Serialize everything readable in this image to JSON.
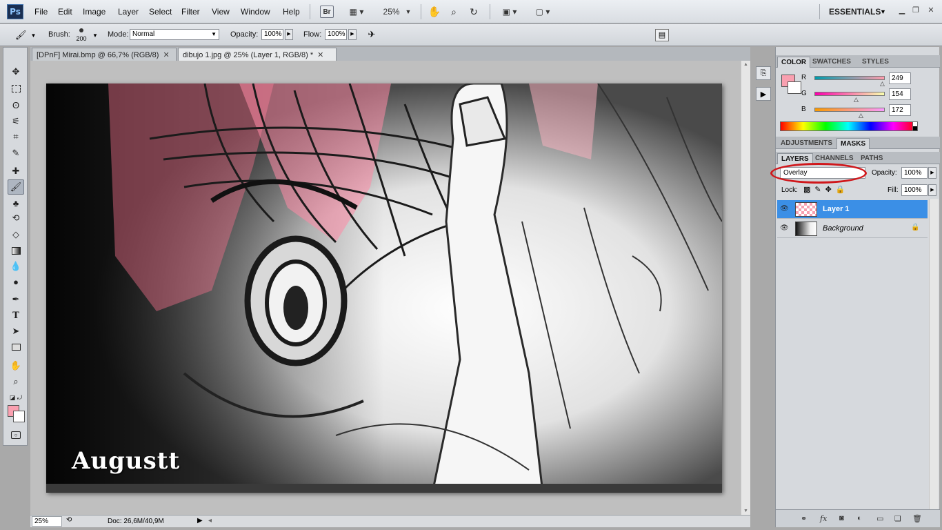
{
  "app": {
    "logo": "Ps",
    "menu": [
      "File",
      "Edit",
      "Image",
      "Layer",
      "Select",
      "Filter",
      "View",
      "Window",
      "Help"
    ],
    "bridge_label": "Br",
    "zoom": "25%",
    "workspace": "ESSENTIALS"
  },
  "options": {
    "brush_label": "Brush:",
    "brush_size": "200",
    "mode_label": "Mode:",
    "mode_value": "Normal",
    "opacity_label": "Opacity:",
    "opacity_value": "100%",
    "flow_label": "Flow:",
    "flow_value": "100%"
  },
  "tabs": [
    {
      "label": "[DPnF] Mirai.bmp @ 66,7% (RGB/8)",
      "active": false
    },
    {
      "label": "dibujo 1.jpg @ 25% (Layer 1, RGB/8) *",
      "active": true
    }
  ],
  "canvas": {
    "signature": "Augustt"
  },
  "status": {
    "zoom": "25%",
    "doc": "Doc: 26,6M/40,9M"
  },
  "color_panel": {
    "tabs": [
      "COLOR",
      "SWATCHES",
      "STYLES"
    ],
    "foreground": "#f9a0b0",
    "channels": [
      {
        "label": "R",
        "value": "249"
      },
      {
        "label": "G",
        "value": "154"
      },
      {
        "label": "B",
        "value": "172"
      }
    ]
  },
  "adjust_panel": {
    "tabs": [
      "ADJUSTMENTS",
      "MASKS"
    ]
  },
  "layers_panel": {
    "tabs": [
      "LAYERS",
      "CHANNELS",
      "PATHS"
    ],
    "blend_mode": "Overlay",
    "opacity_label": "Opacity:",
    "opacity_value": "100%",
    "lock_label": "Lock:",
    "fill_label": "Fill:",
    "fill_value": "100%",
    "layers": [
      {
        "name": "Layer 1",
        "selected": true
      },
      {
        "name": "Background",
        "selected": false,
        "locked": true
      }
    ]
  }
}
